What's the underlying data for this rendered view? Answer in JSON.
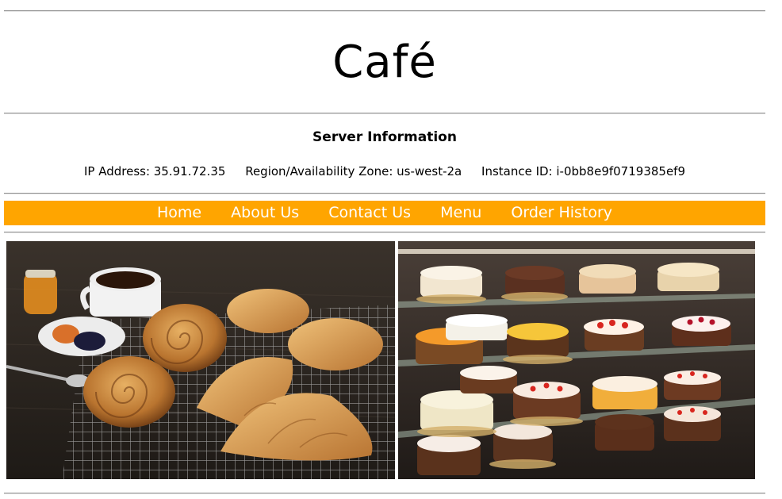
{
  "header": {
    "title": "Café"
  },
  "server_info": {
    "heading": "Server Information",
    "ip_address": "IP Address: 35.91.72.35",
    "region": "Region/Availability Zone: us-west-2a",
    "instance_id": "Instance ID: i-0bb8e9f0719385ef9"
  },
  "nav": {
    "items": [
      {
        "label": "Home"
      },
      {
        "label": "About Us"
      },
      {
        "label": "Contact Us"
      },
      {
        "label": "Menu"
      },
      {
        "label": "Order History"
      }
    ],
    "background_color": "#ffa500",
    "text_color": "#ffffff"
  },
  "images": [
    {
      "name": "pastries-photo"
    },
    {
      "name": "cake-display-photo"
    }
  ]
}
